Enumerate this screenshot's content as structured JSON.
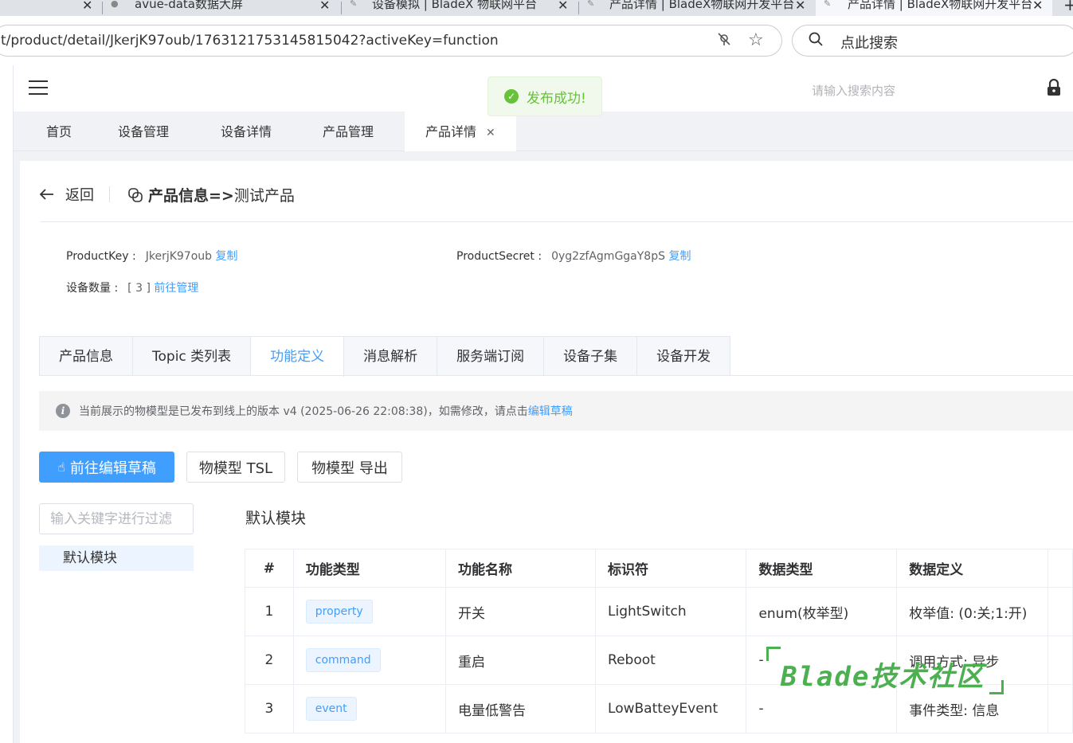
{
  "browser": {
    "tabs": [
      {
        "title": "avue-data数据大屏"
      },
      {
        "title": "设备模拟 | BladeX 物联网平台"
      },
      {
        "title": "产品详情 | BladeX物联网开发平台"
      },
      {
        "title": "产品详情 | BladeX物联网开发平台"
      }
    ],
    "url": "t/product/detail/JkerjK97oub/1763121753145815042?activeKey=function",
    "search_placeholder": "点此搜索"
  },
  "header": {
    "search_placeholder": "请输入搜索内容"
  },
  "toast": {
    "message": "发布成功!"
  },
  "route_tabs": [
    {
      "label": "首页"
    },
    {
      "label": "设备管理"
    },
    {
      "label": "设备详情"
    },
    {
      "label": "产品管理"
    },
    {
      "label": "产品详情"
    }
  ],
  "page": {
    "back_label": "返回",
    "title_bold": "产品信息=>",
    "title_rest": " 测试产品",
    "product_key_label": "ProductKey :",
    "product_key_value": "JkerjK97oub",
    "product_secret_label": "ProductSecret :",
    "product_secret_value": "0yg2zfAgmGgaY8pS",
    "copy_label": "复制",
    "device_count_label": "设备数量 :",
    "device_count_value": "[ 3 ]",
    "manage_link": "前往管理"
  },
  "inner_tabs": [
    {
      "label": "产品信息"
    },
    {
      "label": "Topic 类列表"
    },
    {
      "label": "功能定义"
    },
    {
      "label": "消息解析"
    },
    {
      "label": "服务端订阅"
    },
    {
      "label": "设备子集"
    },
    {
      "label": "设备开发"
    }
  ],
  "alert": {
    "text": "当前展示的物模型是已发布到线上的版本 v4 (2025-06-26 22:08:38)，如需修改，请点击",
    "link": "编辑草稿"
  },
  "buttons": {
    "edit_draft": "前往编辑草稿",
    "tsl": "物模型 TSL",
    "export": "物模型 导出"
  },
  "filter": {
    "placeholder": "输入关键字进行过滤"
  },
  "tree": {
    "item": "默认模块"
  },
  "module_title": "默认模块",
  "table": {
    "headers": [
      "#",
      "功能类型",
      "功能名称",
      "标识符",
      "数据类型",
      "数据定义"
    ],
    "rows": [
      {
        "idx": "1",
        "type": "property",
        "name": "开关",
        "identifier": "LightSwitch",
        "dtype": "enum(枚举型)",
        "def": "枚举值: (0:关;1:开)"
      },
      {
        "idx": "2",
        "type": "command",
        "name": "重启",
        "identifier": "Reboot",
        "dtype": "-",
        "def": "调用方式: 异步"
      },
      {
        "idx": "3",
        "type": "event",
        "name": "电量低警告",
        "identifier": "LowBatteyEvent",
        "dtype": "-",
        "def": "事件类型: 信息"
      }
    ]
  },
  "watermark": "Blade技术社区",
  "colors": {
    "primary": "#409eff",
    "success": "#67c23a",
    "watermark": "#4caf50"
  }
}
